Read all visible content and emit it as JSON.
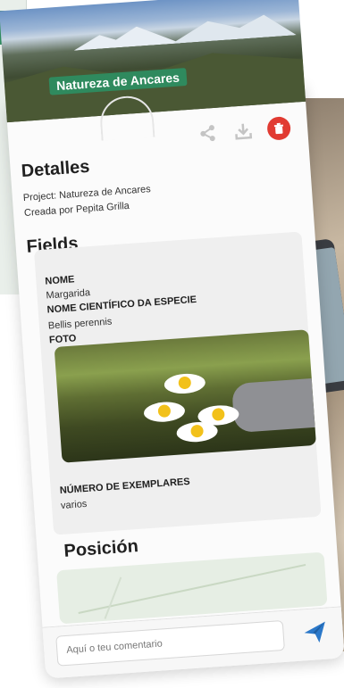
{
  "background": {
    "left_bar_symbol": "s",
    "left_gear_icon": "gear-icon"
  },
  "hero": {
    "title": "Natureza de Ancares"
  },
  "actions": {
    "share_icon": "share-icon",
    "download_icon": "download-icon",
    "delete_icon": "trash-icon"
  },
  "details": {
    "title": "Detalles",
    "project_line": "Project: Natureza de Ancares",
    "creator_line": "Creada por Pepita Grilla"
  },
  "fields": {
    "title": "Fields",
    "items": [
      {
        "label": "NOME",
        "value": "Margarida"
      },
      {
        "label": "NOME CIENTÍFICO DA ESPECIE",
        "value": "Bellis perennis"
      },
      {
        "label": "FOTO",
        "value": ""
      },
      {
        "label": "NÚMERO DE EXEMPLARES",
        "value": "varios"
      }
    ]
  },
  "position": {
    "title": "Posición"
  },
  "comment": {
    "placeholder": "Aquí o teu comentario",
    "send_icon": "send-icon"
  },
  "colors": {
    "accent_green": "#2f8a5e",
    "delete_red": "#e13b32",
    "send_blue": "#2b78c9"
  }
}
